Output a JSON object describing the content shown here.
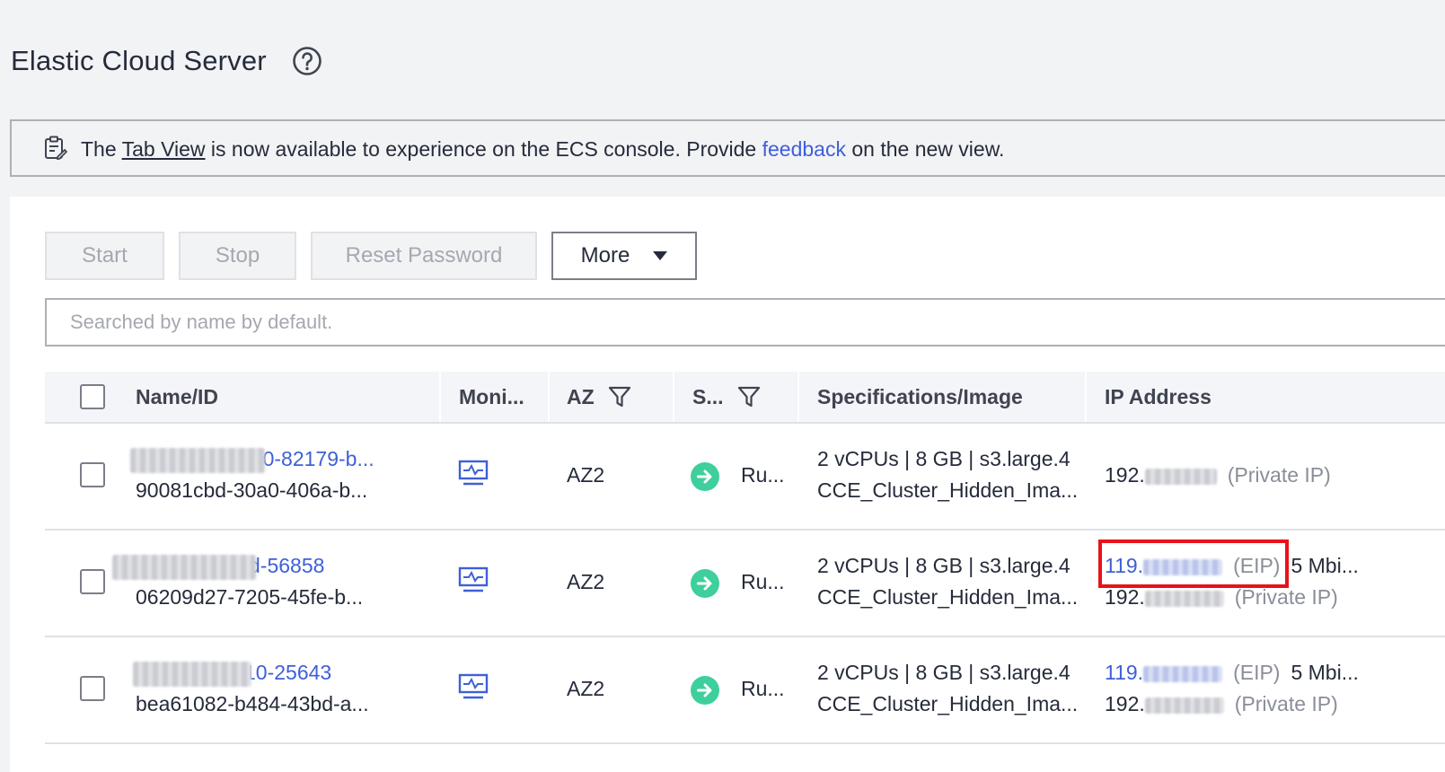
{
  "header": {
    "title": "Elastic Cloud Server"
  },
  "notice": {
    "prefix": "The ",
    "tab_view_link": "Tab View",
    "middle": " is now available to experience on the ECS console. Provide ",
    "feedback_link": "feedback",
    "suffix": " on the new view."
  },
  "toolbar": {
    "start_label": "Start",
    "stop_label": "Stop",
    "reset_password_label": "Reset Password",
    "more_label": "More"
  },
  "search": {
    "placeholder": "Searched by name by default."
  },
  "table": {
    "columns": {
      "name_id": "Name/ID",
      "monitoring": "Moni...",
      "az": "AZ",
      "status": "S...",
      "spec_image": "Specifications/Image",
      "ip_address": "IP Address"
    },
    "rows": [
      {
        "name_suffix": "310-82179-b...",
        "id": "90081cbd-30a0-406a-b...",
        "az": "AZ2",
        "status": "Ru...",
        "spec": "2 vCPUs | 8 GB | s3.large.4",
        "image": "CCE_Cluster_Hidden_Ima...",
        "private_ip_prefix": "192.",
        "private_ip_label": "(Private IP)"
      },
      {
        "name_suffix": "d-56858",
        "id": "06209d27-7205-45fe-b...",
        "az": "AZ2",
        "status": "Ru...",
        "spec": "2 vCPUs | 8 GB | s3.large.4",
        "image": "CCE_Cluster_Hidden_Ima...",
        "eip_prefix": "119.",
        "eip_label": "(EIP)",
        "bandwidth": "5 Mbi...",
        "private_ip_prefix": "192.",
        "private_ip_label": "(Private IP)"
      },
      {
        "name_suffix": "10-25643",
        "id": "bea61082-b484-43bd-a...",
        "az": "AZ2",
        "status": "Ru...",
        "spec": "2 vCPUs | 8 GB | s3.large.4",
        "image": "CCE_Cluster_Hidden_Ima...",
        "eip_prefix": "119.",
        "eip_label": "(EIP)",
        "bandwidth": "5 Mbi...",
        "private_ip_prefix": "192.",
        "private_ip_label": "(Private IP)"
      }
    ]
  },
  "colors": {
    "link": "#3f5fd8",
    "status_running": "#3ecf9c",
    "highlight": "#e8121b"
  }
}
